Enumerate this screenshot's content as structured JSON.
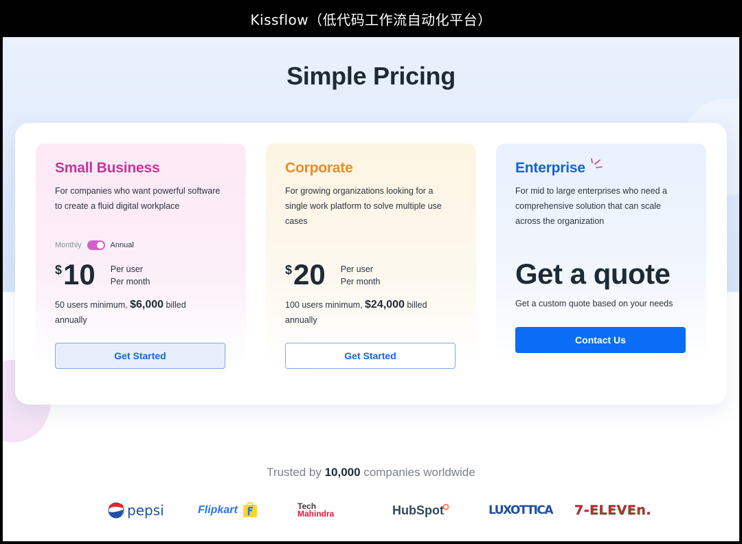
{
  "window": {
    "title": "Kissflow（低代码工作流自动化平台）"
  },
  "page": {
    "title": "Simple Pricing"
  },
  "plans": {
    "small": {
      "name": "Small Business",
      "description": "For companies who want powerful software to create a fluid digital workplace",
      "toggle": {
        "left_label": "Monthly",
        "right_label": "Annual",
        "selected": "Annual"
      },
      "currency": "$",
      "amount": "10",
      "per_user": "Per user",
      "per_month": "Per month",
      "minimum_prefix": "50 users minimum,",
      "minimum_amount": "$6,000",
      "minimum_suffix": "billed annually",
      "cta": "Get Started",
      "accent": "#c3379c"
    },
    "corporate": {
      "name": "Corporate",
      "description": "For growing organizations looking for a single work platform to solve multiple use cases",
      "currency": "$",
      "amount": "20",
      "per_user": "Per user",
      "per_month": "Per month",
      "minimum_prefix": "100 users minimum,",
      "minimum_amount": "$24,000",
      "minimum_suffix": "billed annually",
      "cta": "Get Started",
      "accent": "#ec8a2c"
    },
    "enterprise": {
      "name": "Enterprise",
      "description": "For mid to large enterprises who need a comprehensive solution that can scale across the organization",
      "headline": "Get a quote",
      "subtext": "Get a custom quote based on your needs",
      "cta": "Contact Us",
      "accent": "#1663cc",
      "cta_color": "#0b6cf5"
    }
  },
  "trusted": {
    "prefix": "Trusted by",
    "count": "10,000",
    "suffix": "companies worldwide"
  },
  "logos": {
    "pepsi": "pepsi",
    "flipkart": "Flipkart",
    "techm_line1": "Tech",
    "techm_line2": "Mahindra",
    "hubspot": "HubSpot",
    "luxottica": "LUXOTTICA",
    "seven_eleven": "7-ELEVEn."
  }
}
